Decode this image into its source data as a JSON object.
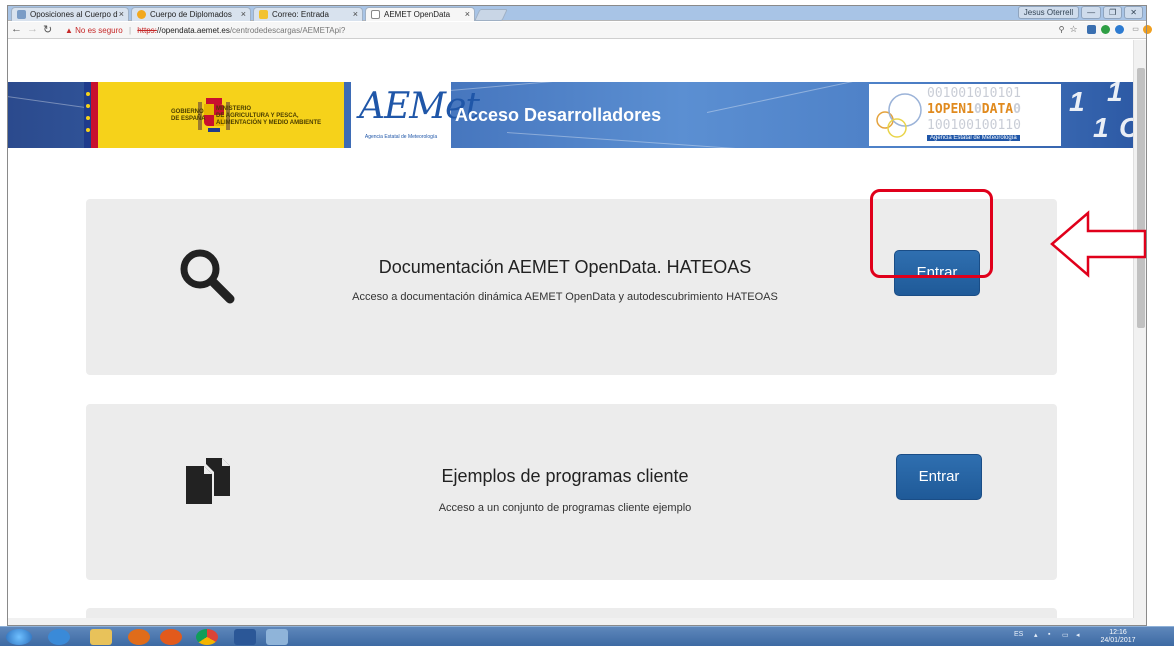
{
  "browser": {
    "tabs": [
      {
        "label": "Oposiciones al Cuerpo d",
        "favicon_color": "#7a9cc6",
        "active": false
      },
      {
        "label": "Cuerpo de Diplomados",
        "favicon_color": "#f2a81d",
        "active": false
      },
      {
        "label": "Correo: Entrada",
        "favicon_color": "#f2c230",
        "active": false
      },
      {
        "label": "AEMET OpenData",
        "favicon_color": "#ffffff",
        "active": true
      }
    ],
    "tab_close": "×",
    "window_buttons": [
      "Jesus Oterrell",
      "—",
      "❐",
      "✕"
    ],
    "security_label": "No es seguro",
    "url_protocol": "https:",
    "url_host": "//opendata.aemet.es",
    "url_path": "/centrodedescargas/AEMETApi?"
  },
  "banner": {
    "gov_line1": "GOBIERNO\nDE ESPAÑA",
    "gov_line2": "MINISTERIO\nDE AGRICULTURA Y PESCA,\nALIMENTACIÓN Y MEDIO AMBIENTE",
    "aemet_word": "AEMet",
    "aemet_sub": "Agencia Estatal de Meteorología",
    "title": "Acceso Desarrolladores",
    "od_bin1": "001001010101",
    "od_open": "1OPEN1",
    "od_mid": "0",
    "od_data": "DATA",
    "od_end": "0",
    "od_bin3": "100100100110",
    "od_agency": "Agencia Estatal de Meteorología"
  },
  "cards": [
    {
      "title": "Documentación AEMET OpenData. HATEOAS",
      "description": "Acceso a documentación dinámica AEMET OpenData y autodescubrimiento HATEOAS",
      "button": "Entrar",
      "icon": "search-icon"
    },
    {
      "title": "Ejemplos de programas cliente",
      "description": "Acceso a un conjunto de programas cliente ejemplo",
      "button": "Entrar",
      "icon": "documents-icon"
    }
  ],
  "taskbar": {
    "lang": "ES",
    "time": "12:16",
    "date": "24/01/2017"
  },
  "colors": {
    "highlight": "#e0001b",
    "button": "#2a67a8",
    "card_bg": "#ececec"
  }
}
